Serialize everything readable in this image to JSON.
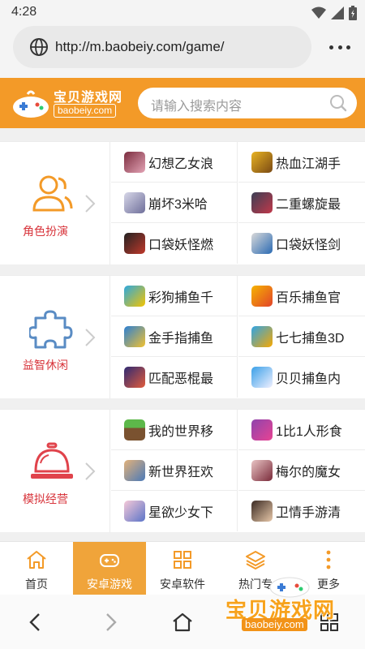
{
  "status_bar": {
    "time": "4:28"
  },
  "browser": {
    "url": "http://m.baobeiy.com/game/"
  },
  "header": {
    "logo_title": "宝贝游戏网",
    "logo_domain": "baobeiy.com",
    "search_placeholder": "请输入搜索内容"
  },
  "colors": {
    "brand": "#f39a28",
    "category_text": "#d8353c",
    "active_nav": "#f0a43a"
  },
  "sections": [
    {
      "label": "角色扮演",
      "icon": "people-icon",
      "games": [
        "幻想乙女浪",
        "热血江湖手",
        "崩坏3米哈",
        "二重螺旋最",
        "口袋妖怪燃",
        "口袋妖怪剑"
      ]
    },
    {
      "label": "益智休闲",
      "icon": "puzzle-icon",
      "games": [
        "彩狗捕鱼千",
        "百乐捕鱼官",
        "金手指捕鱼",
        "七七捕鱼3D",
        "匹配恶棍最",
        "贝贝捕鱼内"
      ]
    },
    {
      "label": "模拟经营",
      "icon": "service-bell-icon",
      "games": [
        "我的世界移",
        "1比1人形食",
        "新世界狂欢",
        "梅尔的魔女",
        "星欲少女下",
        "卫情手游清"
      ]
    }
  ],
  "bottom_nav": [
    {
      "label": "首页",
      "icon": "home-icon"
    },
    {
      "label": "安卓游戏",
      "icon": "gamepad-icon",
      "active": true
    },
    {
      "label": "安卓软件",
      "icon": "grid-icon"
    },
    {
      "label": "热门专",
      "icon": "layers-icon"
    },
    {
      "label": "更多",
      "icon": "more-vertical-icon"
    }
  ],
  "watermark": {
    "title": "宝贝游戏网",
    "domain": "baobeiy.com"
  }
}
